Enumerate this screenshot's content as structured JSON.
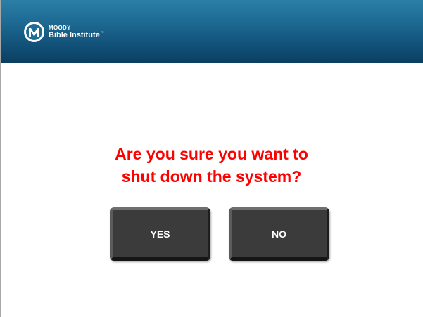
{
  "header": {
    "logo": {
      "icon": "moody-m-logo-icon",
      "line1": "MOODY",
      "line2": "Bible Institute",
      "trademark": "™"
    },
    "gradient_colors": [
      "#2b7fa6",
      "#0b3e60"
    ]
  },
  "dialog": {
    "question_line1": "Are you sure you want to",
    "question_line2": "shut down the system?",
    "question_color": "#ff0000",
    "yes_label": "YES",
    "no_label": "NO",
    "button_color": "#3b3b3b"
  }
}
